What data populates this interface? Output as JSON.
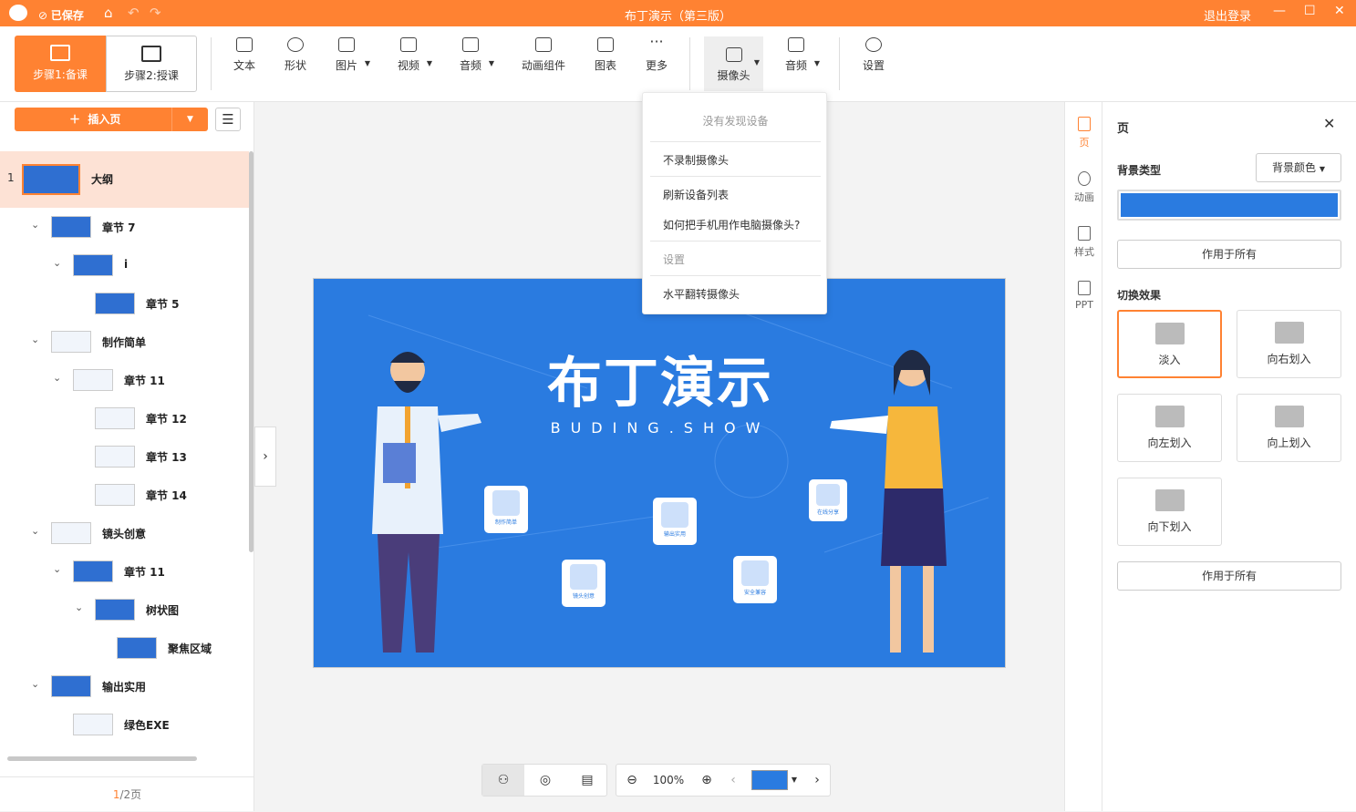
{
  "titlebar": {
    "saved": "已保存",
    "title": "布丁演示（第三版）",
    "logout": "退出登录"
  },
  "steps": [
    {
      "label": "步骤1:备课"
    },
    {
      "label": "步骤2:授课"
    }
  ],
  "tools": [
    {
      "label": "文本"
    },
    {
      "label": "形状"
    },
    {
      "label": "图片"
    },
    {
      "label": "视频"
    },
    {
      "label": "音频"
    },
    {
      "label": "动画组件"
    },
    {
      "label": "图表"
    },
    {
      "label": "更多"
    },
    {
      "label": "摄像头"
    },
    {
      "label": "音频"
    },
    {
      "label": "设置"
    }
  ],
  "left": {
    "insert_label": "插入页",
    "outline": [
      {
        "num": "1",
        "label": "大纲"
      },
      {
        "label": "章节 7"
      },
      {
        "label": "i"
      },
      {
        "label": "章节 5"
      },
      {
        "label": "制作简单"
      },
      {
        "label": "章节 11"
      },
      {
        "label": "章节 12"
      },
      {
        "label": "章节 13"
      },
      {
        "label": "章节 14"
      },
      {
        "label": "镜头创意"
      },
      {
        "label": "章节 11"
      },
      {
        "label": "树状图"
      },
      {
        "label": "聚焦区域"
      },
      {
        "label": "输出实用"
      },
      {
        "label": "绿色EXE"
      }
    ],
    "page_current": "1",
    "page_total": "/2页"
  },
  "camera_menu": {
    "header": "没有发现设备",
    "items": [
      "不录制摄像头",
      "刷新设备列表",
      "如何把手机用作电脑摄像头?",
      "设置",
      "水平翻转摄像头"
    ]
  },
  "slide": {
    "title": "布丁演示",
    "subtitle": "BUDING.SHOW",
    "cards": [
      "制作简单",
      "输出实用",
      "在线分享",
      "镜头创意",
      "安全兼容"
    ]
  },
  "bottom": {
    "zoom": "100%"
  },
  "side_tabs": [
    {
      "label": "页"
    },
    {
      "label": "动画"
    },
    {
      "label": "样式"
    },
    {
      "label": "PPT"
    }
  ],
  "right": {
    "title": "页",
    "bg_type_label": "背景类型",
    "bg_select": "背景颜色",
    "bg_color": "#2a7be0",
    "apply_all_1": "作用于所有",
    "transition_label": "切换效果",
    "transitions": [
      "淡入",
      "向右划入",
      "向左划入",
      "向上划入",
      "向下划入"
    ],
    "apply_all_2": "作用于所有"
  },
  "colors": {
    "accent": "#ff8232",
    "slide_bg": "#2a7be0"
  }
}
